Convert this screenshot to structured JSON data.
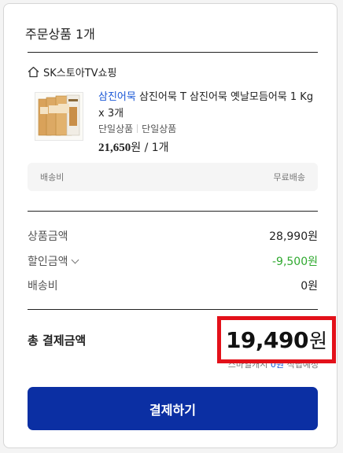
{
  "order": {
    "title": "주문상품 1개"
  },
  "store": {
    "icon": "home-icon",
    "name": "SK스토아TV쇼핑"
  },
  "product": {
    "brand": "삼진어묵",
    "name": " 삼진어묵 T 삼진어묵 옛날모듬어묵 1 Kg x 3개",
    "option_1": "단일상품",
    "option_2": "단일상품",
    "price": "21,650",
    "price_unit": "원",
    "quantity": " / 1개"
  },
  "shipping_box": {
    "label": "배송비",
    "value": "무료배송"
  },
  "summary": {
    "product_amount_label": "상품금액",
    "product_amount_value": "28,990원",
    "discount_label": "할인금액",
    "discount_value": "-9,500원",
    "shipping_label": "배송비",
    "shipping_value": "0원"
  },
  "total": {
    "label": "총 결제금액",
    "amount": "19,490",
    "unit": "원",
    "points_prefix": "스마일캐시 ",
    "points_value": "0원",
    "points_suffix": " 적립예정"
  },
  "pay_button": {
    "label": "결제하기"
  },
  "colors": {
    "accent_blue": "#0b2fa3",
    "brand_link": "#1a57d6",
    "discount_green": "#2fa92f",
    "highlight_red": "#e3111a"
  }
}
